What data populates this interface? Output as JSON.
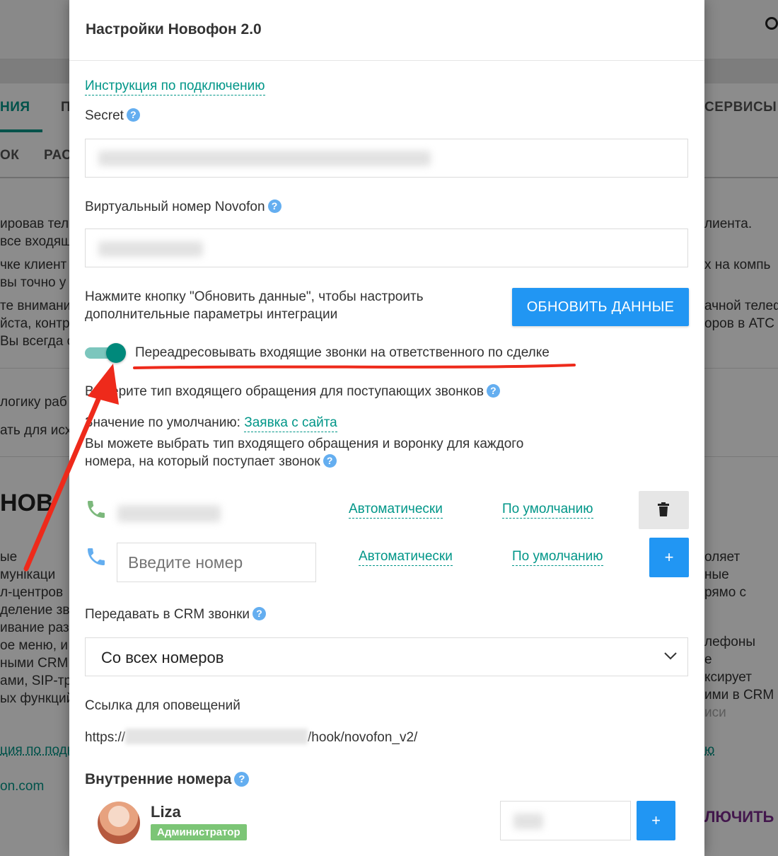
{
  "background": {
    "tabs": [
      "НИЯ",
      "П",
      "СЕРВИСЫ"
    ],
    "subtabs": [
      "ОК",
      "РАС"
    ],
    "left_lines": [
      "ировав тел",
      "все входящ",
      "чке клиент",
      "вы точно у",
      "те внимани",
      "йста, контр",
      "Вы всегда с",
      "логику раб",
      "ать для исх"
    ],
    "right_lines": [
      "лиента.",
      "х на компь",
      "ачной телеф",
      "оров в АТС"
    ],
    "logo": "НОВ",
    "left_lines2": [
      "ые",
      "мунікаци",
      "л-центров",
      "деление зво",
      "ивание раз",
      "ое меню, и",
      "ными CRM",
      "ами, SIP-тра",
      "ых функций"
    ],
    "right_lines2": [
      "оляет",
      "ные",
      "рямо с",
      "лефоны",
      "е",
      "ксирует",
      "ими в CRM",
      "иси"
    ],
    "link_left": "ция по подкл",
    "link_right": "ю",
    "domain_text": "on.com",
    "action_text": "ЛЮЧИТЬ"
  },
  "modal": {
    "title": "Настройки Новофон 2.0",
    "instruction_link": "Инструкция по подключению",
    "secret_label": "Secret",
    "virtual_number_label": "Виртуальный номер Novofon",
    "update_hint_line1": "Нажмите кнопку \"Обновить данные\", чтобы настроить",
    "update_hint_line2": "дополнительные параметры интеграции",
    "update_button": "ОБНОВИТЬ ДАННЫЕ",
    "redirect_toggle_label": "Переадресовывать входящие звонки на ответственного по сделке",
    "redirect_toggle_on": true,
    "incoming_type_label": "Выберите тип входящего обращения для поступающих звонков",
    "default_value_label": "Значение по умолчанию:",
    "default_value_link": "Заявка с сайта",
    "per_number_line1": "Вы можете выбрать тип входящего обращения и воронку для каждого",
    "per_number_line2": "номера, на который поступает звонок",
    "number_rows": [
      {
        "auto_label": "Автоматически",
        "default_label": "По умолчанию"
      },
      {
        "placeholder": "Введите номер",
        "auto_label": "Автоматически",
        "default_label": "По умолчанию"
      }
    ],
    "add_symbol": "+",
    "crm_calls_label": "Передавать в CRM звонки",
    "crm_calls_value": "Со всех номеров",
    "notify_link_label": "Ссылка для оповещений",
    "notify_link_prefix": "https://",
    "notify_link_suffix": "/hook/novofon_v2/",
    "internal_numbers_title": "Внутренние номера",
    "user": {
      "name": "Liza",
      "role": "Администратор"
    },
    "help_symbol": "?"
  },
  "colors": {
    "accent": "#009688",
    "primary_button": "#2196f3",
    "help_icon": "#64aef0",
    "badge": "#7cc576",
    "annotation_red": "#ee2a1b"
  }
}
